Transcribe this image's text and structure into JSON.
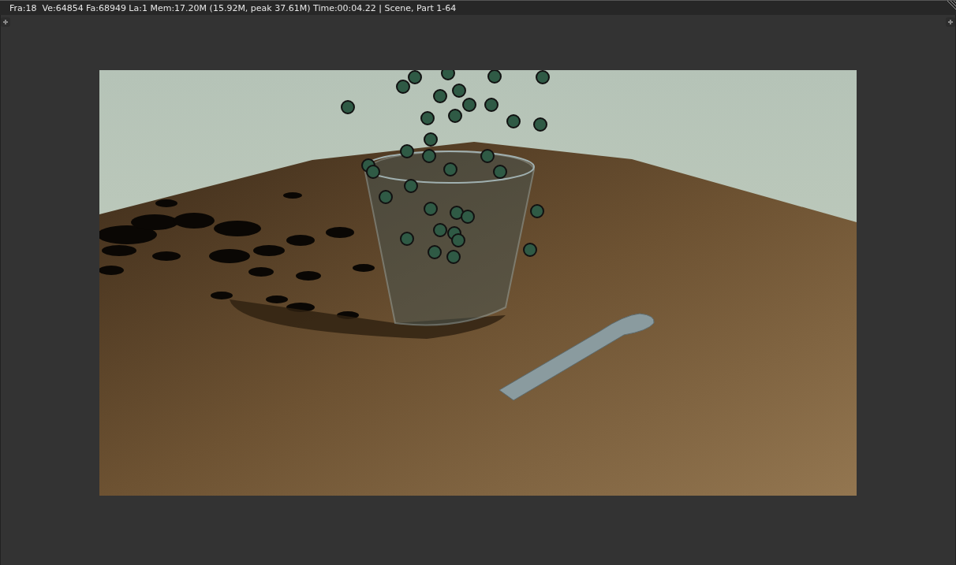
{
  "header": {
    "stats": "Fra:18  Ve:64854 Fa:68949 La:1 Mem:17.20M (15.92M, peak 37.61M) Time:00:04.22 | Scene, Part 1-64"
  }
}
